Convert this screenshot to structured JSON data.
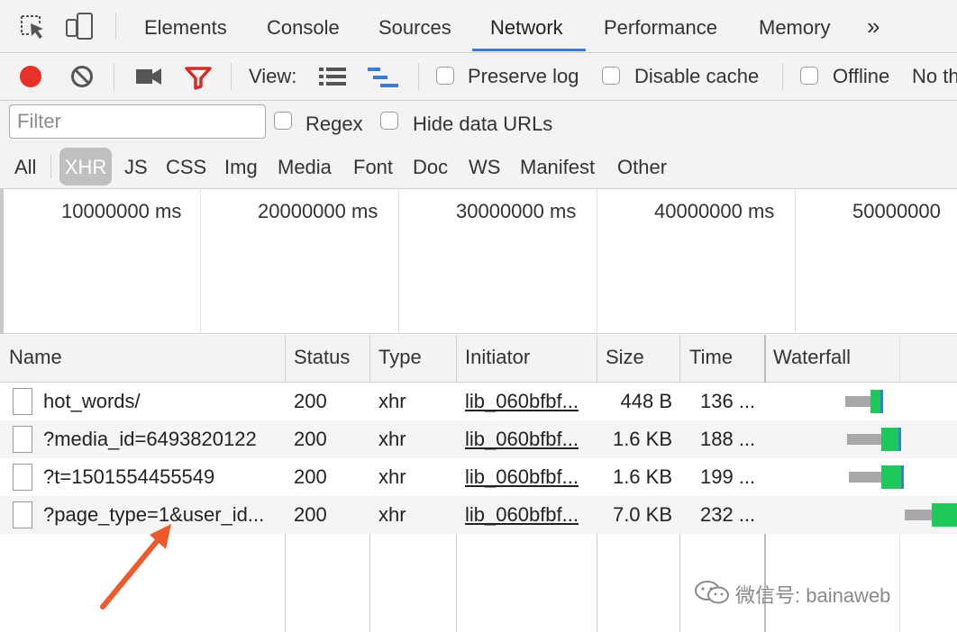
{
  "tabs": [
    "Elements",
    "Console",
    "Sources",
    "Network",
    "Performance",
    "Memory"
  ],
  "active_tab": "Network",
  "tabs_overflow": "»",
  "toolbar": {
    "view_label": "View:",
    "preserve_log": "Preserve log",
    "disable_cache": "Disable cache",
    "offline": "Offline",
    "throttling": "No th"
  },
  "filter": {
    "placeholder": "Filter",
    "regex": "Regex",
    "hide_data_urls": "Hide data URLs"
  },
  "types": [
    "All",
    "XHR",
    "JS",
    "CSS",
    "Img",
    "Media",
    "Font",
    "Doc",
    "WS",
    "Manifest",
    "Other"
  ],
  "active_type": "XHR",
  "overview_ticks": [
    "10000000 ms",
    "20000000 ms",
    "30000000 ms",
    "40000000 ms",
    "50000000"
  ],
  "columns": {
    "name": "Name",
    "status": "Status",
    "type": "Type",
    "initiator": "Initiator",
    "size": "Size",
    "time": "Time",
    "waterfall": "Waterfall"
  },
  "rows": [
    {
      "name": "hot_words/",
      "status": "200",
      "type": "xhr",
      "initiator": "lib_060bfbf...",
      "size": "448 B",
      "time": "136 ..."
    },
    {
      "name": "?media_id=6493820122",
      "status": "200",
      "type": "xhr",
      "initiator": "lib_060bfbf...",
      "size": "1.6 KB",
      "time": "188 ..."
    },
    {
      "name": "?t=1501554455549",
      "status": "200",
      "type": "xhr",
      "initiator": "lib_060bfbf...",
      "size": "1.6 KB",
      "time": "199 ..."
    },
    {
      "name": "?page_type=1&user_id...",
      "status": "200",
      "type": "xhr",
      "initiator": "lib_060bfbf...",
      "size": "7.0 KB",
      "time": "232 ..."
    }
  ],
  "watermark": "微信号: bainaweb",
  "colors": {
    "record": "#e8302a",
    "filter_icon": "#d92b2b",
    "accent": "#3a7bd5",
    "waterfall_receive": "#1fc85a",
    "annotation_arrow": "#ee5a2c"
  }
}
